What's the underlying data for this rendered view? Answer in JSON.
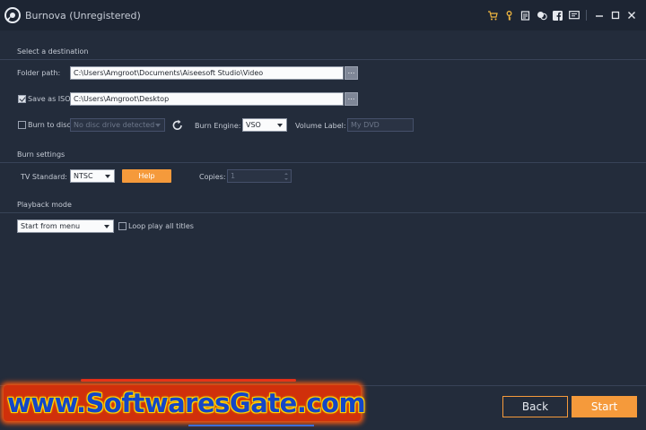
{
  "window": {
    "title": "Burnova (Unregistered)",
    "icons": [
      "cart-icon",
      "key-icon",
      "register-icon",
      "chat-icon",
      "facebook-icon",
      "feedback-icon",
      "minimize-icon",
      "maximize-icon",
      "close-icon"
    ]
  },
  "destination": {
    "section_label": "Select a destination",
    "folder_path_label": "Folder path:",
    "folder_path_value": "C:\\Users\\Amgroot\\Documents\\Aiseesoft Studio\\Video",
    "browse_label": "…",
    "save_as_iso_label": "Save as ISO",
    "save_as_iso_checked": true,
    "iso_path_value": "C:\\Users\\Amgroot\\Desktop",
    "burn_to_disc_label": "Burn to disc",
    "burn_to_disc_checked": false,
    "disc_drive_value": "No disc drive detected",
    "burn_engine_label": "Burn Engine:",
    "burn_engine_value": "VSO",
    "volume_label_label": "Volume Label:",
    "volume_label_placeholder": "My DVD"
  },
  "burn_settings": {
    "section_label": "Burn settings",
    "tv_standard_label": "TV Standard:",
    "tv_standard_value": "NTSC",
    "help_label": "Help",
    "copies_label": "Copies:",
    "copies_value": "1"
  },
  "playback": {
    "section_label": "Playback mode",
    "mode_value": "Start from menu",
    "loop_label": "Loop play all titles",
    "loop_checked": false
  },
  "footer": {
    "back_label": "Back",
    "start_label": "Start",
    "watermark_text": "www.SoftwaresGate.com"
  },
  "colors": {
    "background": "#232c3b",
    "titlebar": "#1d2533",
    "accent": "#f59a3b"
  }
}
